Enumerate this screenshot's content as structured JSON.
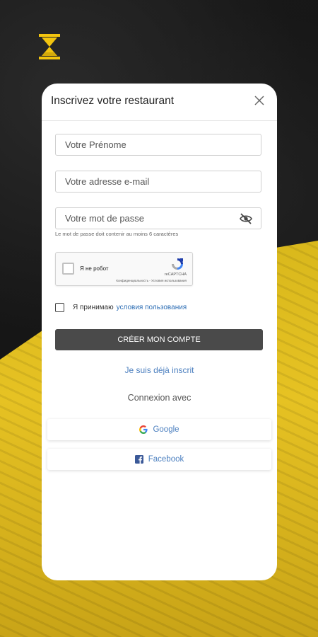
{
  "header": {
    "title": "Inscrivez votre restaurant"
  },
  "form": {
    "first_name_placeholder": "Votre Prénome",
    "email_placeholder": "Votre adresse e-mail",
    "password_placeholder": "Votre mot de passe",
    "password_hint": "Le mot de passe doit contenir au moins 6 caractères"
  },
  "captcha": {
    "label": "Я не робот",
    "brand": "reCAPTCHA",
    "links": "Конфиденциальность - Условия использования"
  },
  "terms": {
    "prefix": "Я принимаю",
    "link": "условия пользования"
  },
  "actions": {
    "create_label": "CRÉER MON COMPTE",
    "already_label": "Je suis déjà inscrit",
    "connect_with_label": "Connexion avec",
    "google_label": "Google",
    "facebook_label": "Facebook"
  },
  "colors": {
    "accent_yellow": "#f2c40f",
    "button_dark": "#4a4a4a",
    "link_blue": "#4b7fbf",
    "facebook_blue": "#3b5998"
  },
  "icons": [
    "hourglass-logo-icon",
    "close-icon",
    "eye-off-icon",
    "recaptcha-icon",
    "google-icon",
    "facebook-icon"
  ]
}
